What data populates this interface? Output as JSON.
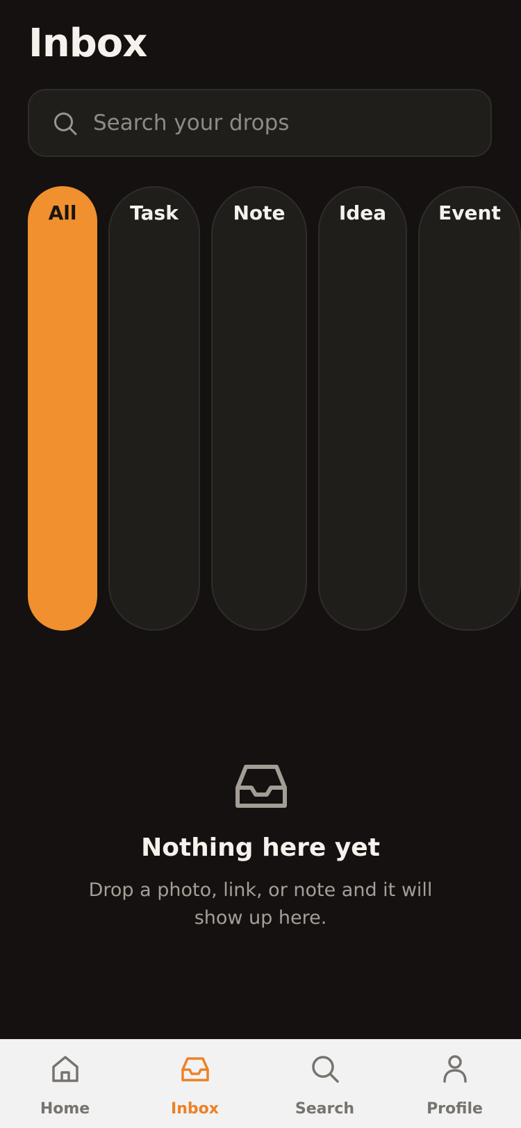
{
  "header": {
    "title": "Inbox"
  },
  "search": {
    "placeholder": "Search your drops",
    "value": "",
    "icon": "search-icon"
  },
  "filters": {
    "selected": "All",
    "items": [
      {
        "label": "All"
      },
      {
        "label": "Task"
      },
      {
        "label": "Note"
      },
      {
        "label": "Idea"
      },
      {
        "label": "Event"
      }
    ]
  },
  "empty_state": {
    "icon": "inbox-tray-icon",
    "title": "Nothing here yet",
    "message": "Drop a photo, link, or note and it will show up here."
  },
  "tabbar": {
    "active": "Inbox",
    "items": [
      {
        "label": "Home",
        "icon": "home-icon"
      },
      {
        "label": "Inbox",
        "icon": "inbox-icon"
      },
      {
        "label": "Search",
        "icon": "search-icon"
      },
      {
        "label": "Profile",
        "icon": "profile-icon"
      }
    ]
  },
  "colors": {
    "background": "#141110",
    "surface": "#201e1b",
    "accent": "#f0902e",
    "tab_active": "#ec8127",
    "tab_inactive": "#77736e",
    "tabbar_background": "#f2f2f2"
  }
}
